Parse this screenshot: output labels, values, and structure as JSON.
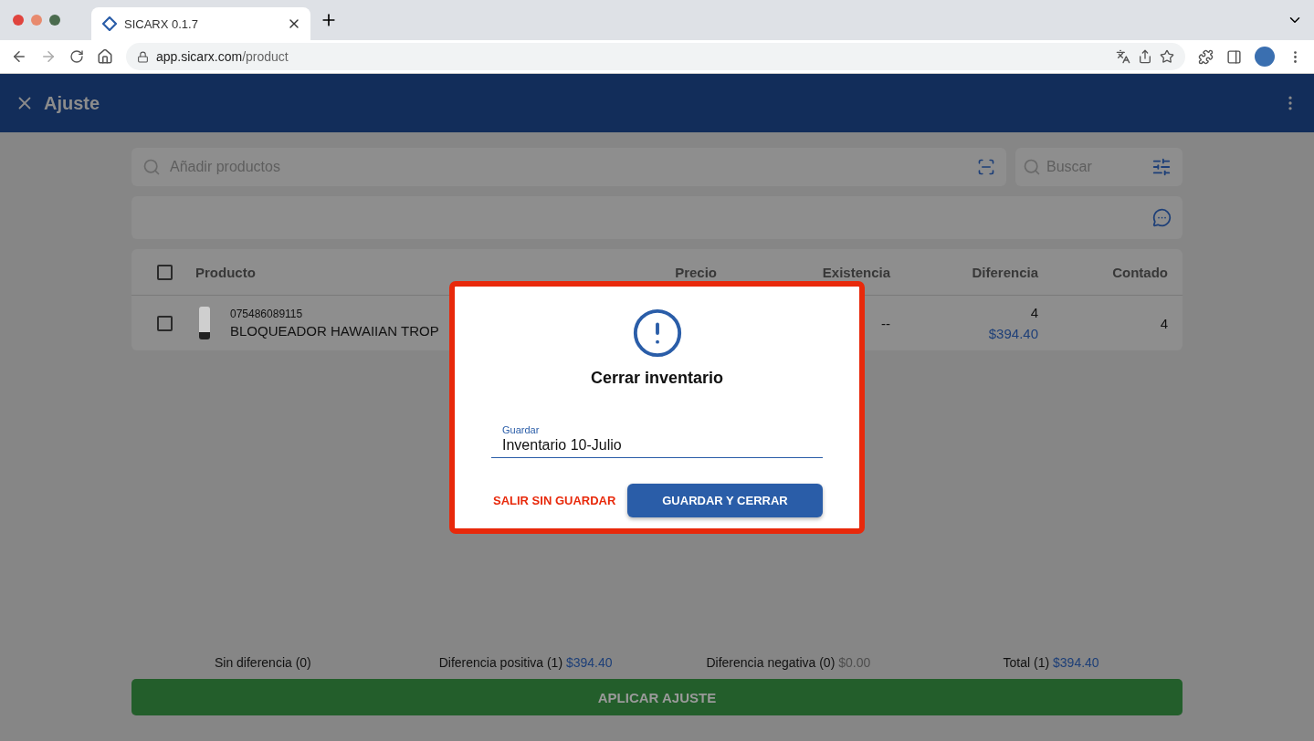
{
  "browser": {
    "tab_title": "SICARX 0.1.7",
    "url_host": "app.sicarx.com",
    "url_path": "/product"
  },
  "app_bar": {
    "title": "Ajuste"
  },
  "search": {
    "placeholder": "Añadir productos"
  },
  "filter_search": {
    "placeholder": "Buscar"
  },
  "table": {
    "select_all_checked": false,
    "columns": [
      "Producto",
      "Precio",
      "Existencia",
      "Diferencia",
      "Contado"
    ],
    "rows": [
      {
        "checked": false,
        "code": "075486089115",
        "name": "BLOQUEADOR HAWAIIAN TROP",
        "existence": "--",
        "difference": "4",
        "difference_amount": "$394.40",
        "counted": "4"
      }
    ]
  },
  "summary": [
    {
      "kind": "plain",
      "label": "Sin diferencia (0)"
    },
    {
      "kind": "positive",
      "label": "Diferencia positiva (1)",
      "amount": "$394.40"
    },
    {
      "kind": "negative",
      "label": "Diferencia negativa (0)",
      "amount": "$0.00"
    },
    {
      "kind": "positive",
      "label": "Total (1)",
      "amount": "$394.40"
    }
  ],
  "apply_button": "APLICAR AJUSTE",
  "dialog": {
    "title": "Cerrar inventario",
    "field_label": "Guardar",
    "field_value": "Inventario 10-Julio",
    "secondary_button": "SALIR SIN GUARDAR",
    "primary_button": "GUARDAR Y CERRAR"
  }
}
